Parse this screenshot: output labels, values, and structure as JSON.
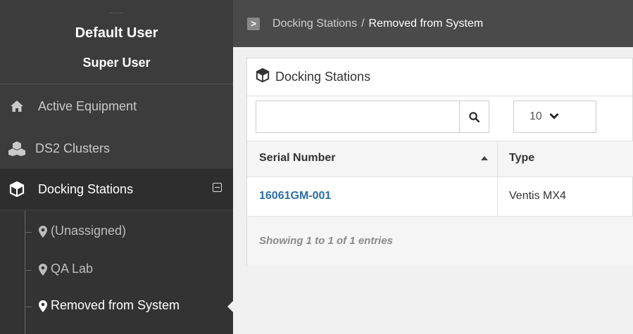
{
  "sidebar": {
    "user_name": "Default User",
    "user_role": "Super User",
    "nav": [
      {
        "label": "Active Equipment",
        "icon": "home-icon"
      },
      {
        "label": "DS2 Clusters",
        "icon": "cubes-icon"
      },
      {
        "label": "Docking Stations",
        "icon": "cube-icon",
        "active": true
      }
    ],
    "sub": [
      {
        "label": "(Unassigned)",
        "icon": "map-marker-icon"
      },
      {
        "label": "QA Lab",
        "icon": "map-marker-icon"
      },
      {
        "label": "Removed from System",
        "icon": "map-marker-icon",
        "active": true
      }
    ]
  },
  "topbar": {
    "toggle_glyph": ">",
    "crumb_parent": "Docking Stations",
    "crumb_sep": "/",
    "crumb_current": "Removed from System"
  },
  "panel": {
    "title": "Docking Stations",
    "search": {
      "value": "",
      "placeholder": ""
    },
    "page_size": "10",
    "columns": [
      "Serial Number",
      "Type"
    ],
    "rows": [
      {
        "serial": "16061GM-001",
        "type": "Ventis MX4"
      }
    ],
    "footer": "Showing 1 to 1 of 1 entries"
  },
  "colors": {
    "sidebar_bg": "#3c3c3c",
    "topbar_bg": "#4a4a4a",
    "link": "#2e6da4",
    "content_bg": "#f0f0f0"
  }
}
